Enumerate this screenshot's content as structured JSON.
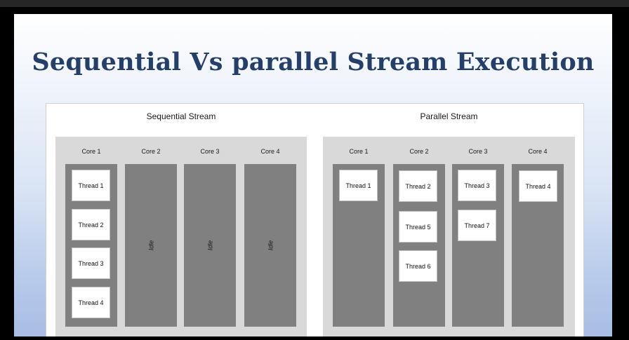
{
  "slide": {
    "title": "Sequential Vs parallel Stream Execution"
  },
  "sequential": {
    "label": "Sequential Stream",
    "cores": [
      {
        "label": "Core 1",
        "threads": [
          "Thread 1",
          "Thread 2",
          "Thread 3",
          "Thread 4"
        ],
        "idle": ""
      },
      {
        "label": "Core 2",
        "threads": [],
        "idle": "Idle"
      },
      {
        "label": "Core 3",
        "threads": [],
        "idle": "Idle"
      },
      {
        "label": "Core 4",
        "threads": [],
        "idle": "Idle"
      }
    ]
  },
  "parallel": {
    "label": "Parallel Stream",
    "cores": [
      {
        "label": "Core 1",
        "threads": [
          "Thread 1"
        ]
      },
      {
        "label": "Core 2",
        "threads": [
          "Thread 2",
          "Thread 5",
          "Thread 6"
        ]
      },
      {
        "label": "Core 3",
        "threads": [
          "Thread 3",
          "Thread 7"
        ]
      },
      {
        "label": "Core 4",
        "threads": [
          "Thread 4"
        ]
      }
    ]
  },
  "colors": {
    "title": "#243f6a",
    "core_column": "#808080",
    "stream_box": "#d9d9d9",
    "thread_box": "#ffffff"
  }
}
